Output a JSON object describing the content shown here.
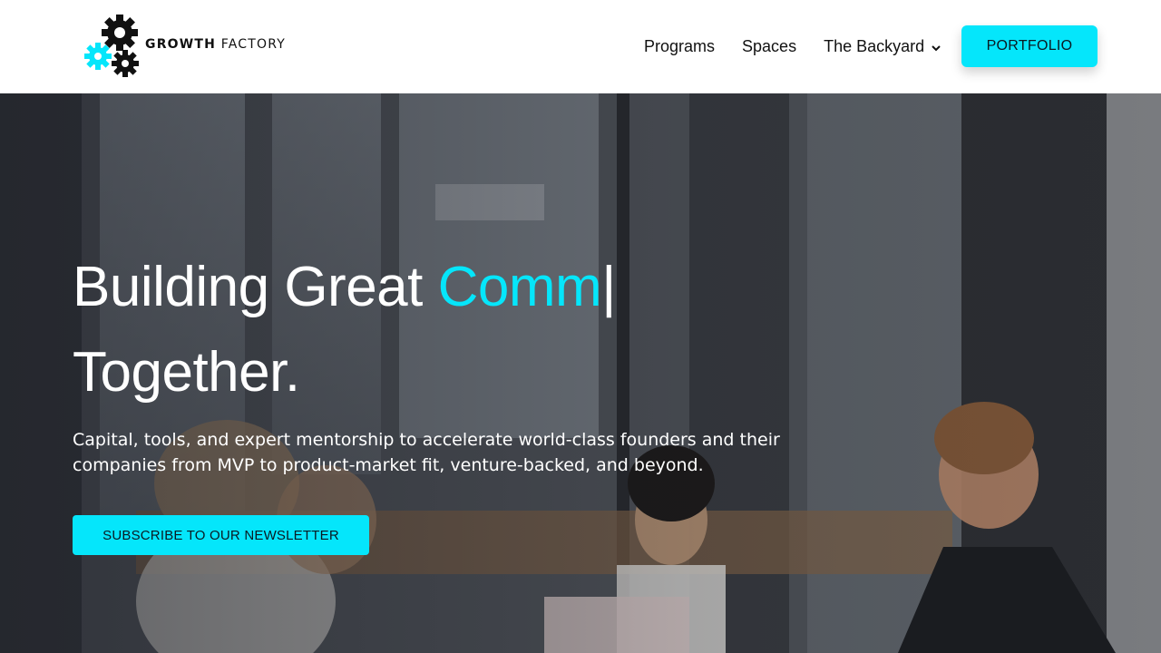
{
  "brand": {
    "name_bold": "GROWTH",
    "name_light": "FACTORY",
    "gear_icon": "gears-logo-icon",
    "accent_color": "#05e6fb"
  },
  "nav": {
    "items": [
      {
        "label": "Programs"
      },
      {
        "label": "Spaces"
      },
      {
        "label": "The Backyard",
        "has_dropdown": true
      }
    ],
    "portfolio_label": "PORTFOLIO"
  },
  "hero": {
    "headline_prefix": "Building Great ",
    "headline_accent": "Comm",
    "headline_cursor": "|",
    "headline_line2": "Together.",
    "subtext": "Capital, tools, and expert mentorship to accelerate world-class founders and their companies from MVP to product-market fit, venture-backed, and beyond.",
    "cta_label": "SUBSCRIBE TO OUR NEWSLETTER",
    "background_image": "photo of young people smiling at a table in a bright office"
  }
}
